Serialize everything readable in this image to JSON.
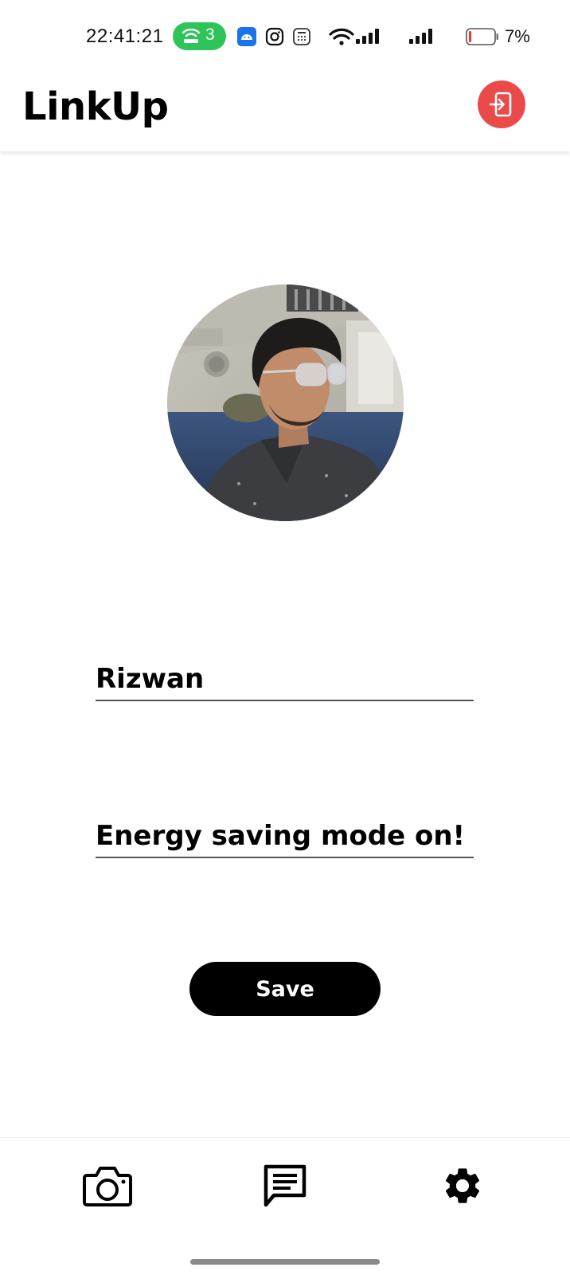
{
  "status_bar": {
    "time": "22:41:21",
    "hotspot_count": "3",
    "battery_percent": "7%",
    "battery_level": 0.07,
    "icons": [
      "hotspot-icon",
      "android-app-icon",
      "instagram-icon",
      "calculator-icon",
      "wifi-icon",
      "signal-icon",
      "signal-icon",
      "battery-icon"
    ]
  },
  "header": {
    "title": "LinkUp",
    "logout_icon": "logout-icon"
  },
  "profile": {
    "name_value": "Rizwan",
    "status_value": "Energy saving mode on!",
    "save_label": "Save"
  },
  "bottom_nav": {
    "items": [
      "camera-icon",
      "chat-icon",
      "settings-icon"
    ]
  },
  "colors": {
    "accent": "#ea4a4a",
    "hotspot": "#2fc45a",
    "primary": "#000000"
  }
}
